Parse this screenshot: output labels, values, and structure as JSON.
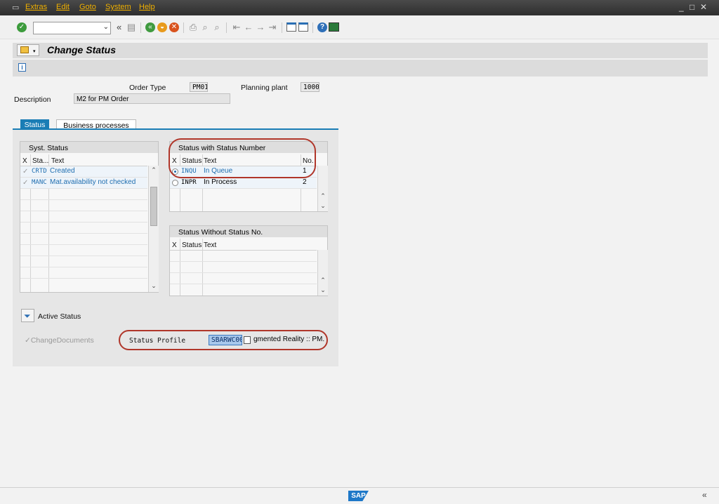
{
  "menu": {
    "items": [
      "Extras",
      "Edit",
      "Goto",
      "System",
      "Help"
    ],
    "window_controls": [
      "_",
      "□",
      "✕"
    ]
  },
  "toolbar": {
    "command_field": "",
    "collapse_glyph": "«"
  },
  "screen": {
    "title": "Change Status"
  },
  "header": {
    "order_type_label": "Order Type",
    "order_type_value": "PM01",
    "planning_plant_label": "Planning plant",
    "planning_plant_value": "1000",
    "description_label": "Description",
    "description_value": "M2 for PM Order"
  },
  "tabs": [
    {
      "label": "Status",
      "active": true
    },
    {
      "label": "Business processes",
      "active": false
    }
  ],
  "syst_status": {
    "title": "Syst. Status",
    "columns": [
      "X",
      "Sta...",
      "Text"
    ],
    "rows": [
      {
        "code": "CRTD",
        "text": "Created"
      },
      {
        "code": "MANC",
        "text": "Mat.availability not checked"
      }
    ]
  },
  "status_with_number": {
    "title": "Status with Status Number",
    "columns": [
      "X",
      "Status",
      "Text",
      "No."
    ],
    "rows": [
      {
        "code": "INQU",
        "text": "In Queue",
        "no": "1",
        "selected": true
      },
      {
        "code": "INPR",
        "text": "In Process",
        "no": "2",
        "selected": false
      }
    ]
  },
  "status_without_number": {
    "title": "Status Without Status No.",
    "columns": [
      "X",
      "Status",
      "Text"
    ]
  },
  "bottom": {
    "active_status_label": "Active Status",
    "change_documents_label": "ChangeDocuments",
    "status_profile_label": "Status Profile",
    "status_profile_value": "SBARWC00",
    "status_profile_desc": "gmented Reality :: PM..."
  },
  "footer": {
    "logo_text": "SAP",
    "collapse_glyph": "«"
  },
  "colors": {
    "accent": "#1a7db5",
    "highlight": "#b0362a",
    "menu_text": "#f0b000"
  }
}
